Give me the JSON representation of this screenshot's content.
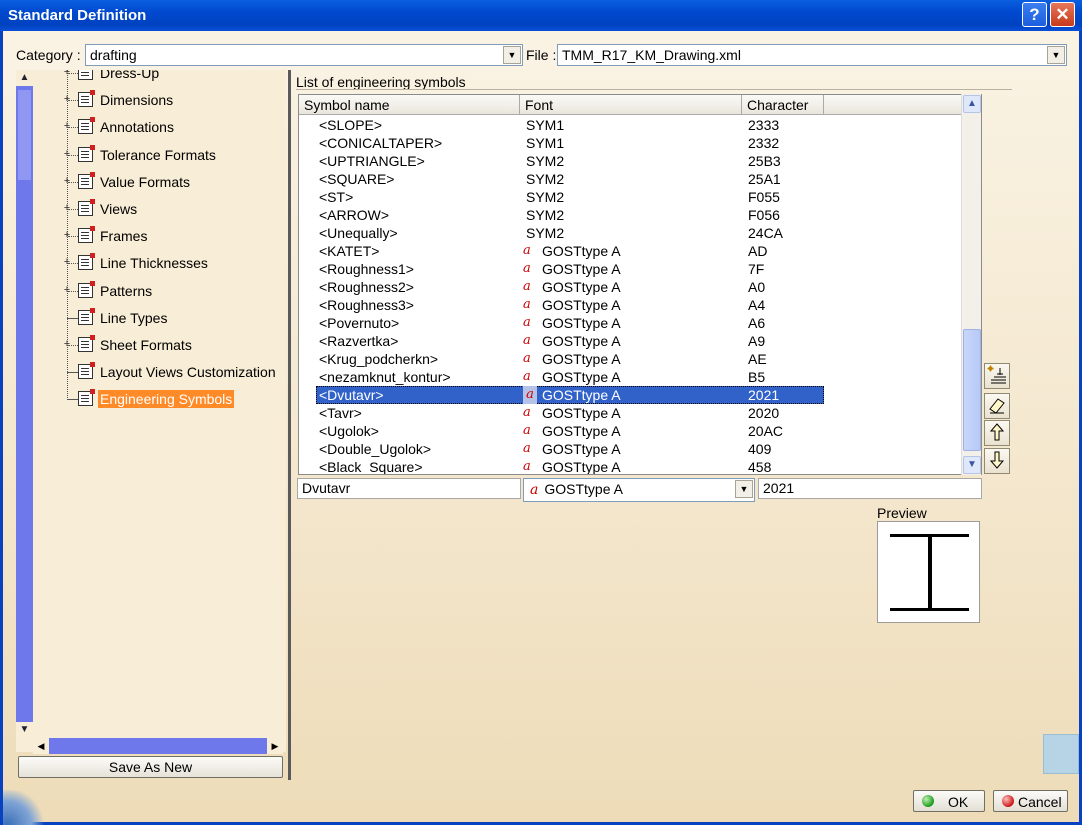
{
  "window": {
    "title": "Standard Definition",
    "help_glyph": "?",
    "close_glyph": "✕"
  },
  "category": {
    "label": "Category :",
    "value": "drafting"
  },
  "file": {
    "label": "File :",
    "value": "TMM_R17_KM_Drawing.xml"
  },
  "tree": {
    "items": [
      {
        "label": "Dress-Up",
        "expandable": true
      },
      {
        "label": "Dimensions",
        "expandable": true
      },
      {
        "label": "Annotations",
        "expandable": true
      },
      {
        "label": "Tolerance Formats",
        "expandable": true
      },
      {
        "label": "Value Formats",
        "expandable": true
      },
      {
        "label": "Views",
        "expandable": true
      },
      {
        "label": "Frames",
        "expandable": true
      },
      {
        "label": "Line Thicknesses",
        "expandable": true
      },
      {
        "label": "Patterns",
        "expandable": true
      },
      {
        "label": "Line Types",
        "expandable": false
      },
      {
        "label": "Sheet Formats",
        "expandable": true
      },
      {
        "label": "Layout Views Customization",
        "expandable": false
      },
      {
        "label": "Engineering Symbols",
        "expandable": false,
        "selected": true
      }
    ]
  },
  "save_as_new_label": "Save As New",
  "symbols": {
    "title": "List of engineering symbols",
    "columns": [
      "Symbol name",
      "Font",
      "Character"
    ],
    "rows": [
      {
        "name": "<SLOPE>",
        "font": "SYM1",
        "char": "2333",
        "gost": false
      },
      {
        "name": "<CONICALTAPER>",
        "font": "SYM1",
        "char": "2332",
        "gost": false
      },
      {
        "name": "<UPTRIANGLE>",
        "font": "SYM2",
        "char": "25B3",
        "gost": false
      },
      {
        "name": "<SQUARE>",
        "font": "SYM2",
        "char": "25A1",
        "gost": false
      },
      {
        "name": "<ST>",
        "font": "SYM2",
        "char": "F055",
        "gost": false
      },
      {
        "name": "<ARROW>",
        "font": "SYM2",
        "char": "F056",
        "gost": false
      },
      {
        "name": "<Unequally>",
        "font": "SYM2",
        "char": "24CA",
        "gost": false
      },
      {
        "name": "<KATET>",
        "font": "GOSTtype A",
        "char": "AD",
        "gost": true
      },
      {
        "name": "<Roughness1>",
        "font": "GOSTtype A",
        "char": "7F",
        "gost": true
      },
      {
        "name": "<Roughness2>",
        "font": "GOSTtype A",
        "char": "A0",
        "gost": true
      },
      {
        "name": "<Roughness3>",
        "font": "GOSTtype A",
        "char": "A4",
        "gost": true
      },
      {
        "name": "<Povernuto>",
        "font": "GOSTtype A",
        "char": "A6",
        "gost": true
      },
      {
        "name": "<Razvertka>",
        "font": "GOSTtype A",
        "char": "A9",
        "gost": true
      },
      {
        "name": "<Krug_podcherkn>",
        "font": "GOSTtype A",
        "char": "AE",
        "gost": true
      },
      {
        "name": "<nezamknut_kontur>",
        "font": "GOSTtype A",
        "char": "B5",
        "gost": true
      },
      {
        "name": "<Dvutavr>",
        "font": "GOSTtype A",
        "char": "2021",
        "gost": true,
        "selected": true
      },
      {
        "name": "<Tavr>",
        "font": "GOSTtype A",
        "char": "2020",
        "gost": true
      },
      {
        "name": "<Ugolok>",
        "font": "GOSTtype A",
        "char": "20AC",
        "gost": true
      },
      {
        "name": "<Double_Ugolok>",
        "font": "GOSTtype A",
        "char": "409",
        "gost": true
      },
      {
        "name": "<Black_Square>",
        "font": "GOSTtype A",
        "char": "458",
        "gost": true
      }
    ]
  },
  "gost_glyph": "a",
  "edit": {
    "name": "Dvutavr",
    "font": "GOSTtype A",
    "char": "2021"
  },
  "preview_label": "Preview",
  "buttons": {
    "ok": "OK",
    "cancel": "Cancel"
  },
  "colors": {
    "selection": "#3162c9",
    "tree_selected": "#ff8a28",
    "titlebar": "#0049cf"
  }
}
